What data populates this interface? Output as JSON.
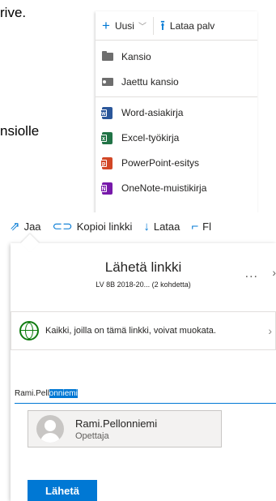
{
  "document": {
    "line1": "rive.",
    "line2": "nsiolle"
  },
  "new_menu": {
    "new_label": "Uusi",
    "upload_label": "Lataa palv",
    "items": [
      {
        "label": "Kansio",
        "icon": "folder-icon"
      },
      {
        "label": "Jaettu kansio",
        "icon": "shared-folder-icon"
      },
      {
        "label": "Word-asiakirja",
        "icon": "word-icon"
      },
      {
        "label": "Excel-työkirja",
        "icon": "excel-icon"
      },
      {
        "label": "PowerPoint-esitys",
        "icon": "powerpoint-icon"
      },
      {
        "label": "OneNote-muistikirja",
        "icon": "onenote-icon"
      }
    ]
  },
  "share_toolbar": {
    "share_label": "Jaa",
    "copy_link_label": "Kopioi linkki",
    "download_label": "Lataa",
    "flow_label": "Fl"
  },
  "share_dialog": {
    "title": "Lähetä linkki",
    "subtitle": "LV 8B 2018-20... (2 kohdetta)",
    "more": "...",
    "permission_text": "Kaikki, joilla on tämä linkki, voivat muokata.",
    "input": {
      "typed": "Rami.Pell",
      "autocomplete_selected": "onniemi"
    },
    "suggestion": {
      "name": "Rami.Pellonniemi",
      "role": "Opettaja"
    },
    "send_label": "Lähetä"
  },
  "colors": {
    "accent": "#0078d4",
    "globe": "#107c10"
  }
}
